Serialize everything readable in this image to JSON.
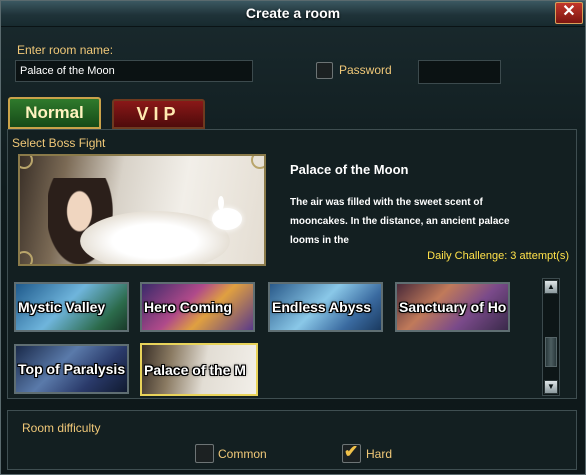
{
  "dialog": {
    "title": "Create a room",
    "close_label": "✕"
  },
  "room": {
    "name_label": "Enter room name:",
    "name_value": "Palace of the Moon",
    "password_label": "Password",
    "password_checked": false
  },
  "tabs": [
    {
      "label": "Normal",
      "active": true
    },
    {
      "label": "VIP",
      "active": false
    }
  ],
  "boss": {
    "section_label": "Select Boss Fight",
    "selected_title": "Palace of the Moon",
    "description": "The air was filled with the sweet scent of mooncakes. In the distance, an ancient palace looms in the",
    "daily_challenge": "Daily Challenge: 3 attempt(s)",
    "list": [
      {
        "name": "Mystic Valley"
      },
      {
        "name": "Hero Coming"
      },
      {
        "name": "Endless Abyss"
      },
      {
        "name": "Sanctuary of Ho"
      },
      {
        "name": "Top of Paralysis"
      },
      {
        "name": "Palace of the M",
        "selected": true
      }
    ]
  },
  "scrollbar": {
    "up_icon": "▲",
    "down_icon": "▼"
  },
  "difficulty": {
    "label": "Room difficulty",
    "options": [
      {
        "label": "Common",
        "checked": false
      },
      {
        "label": "Hard",
        "checked": true
      }
    ],
    "check_glyph": "✔"
  },
  "colors": {
    "accent_gold": "#f0c878",
    "daily_yellow": "#ffe14a",
    "tab_normal": "#2f7a2c",
    "tab_vip": "#8a1818"
  }
}
